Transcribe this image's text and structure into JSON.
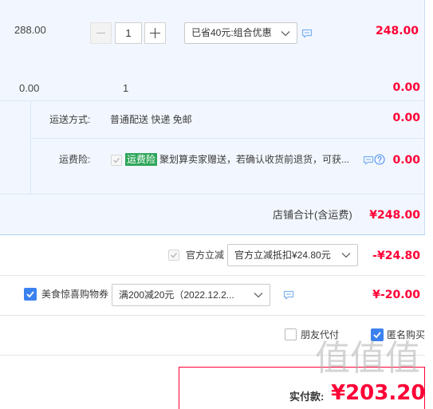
{
  "colors": {
    "price_red": "#ff0036",
    "section_bg": "#f2f7ff",
    "checkbox_blue": "#3b82f0",
    "tag_green": "#2ea65a",
    "icon_blue": "#7fb2ee"
  },
  "icons": {
    "minus": "minus-icon",
    "plus": "plus-icon",
    "dropdown": "chevron-down-icon",
    "chat": "chat-bubble-icon",
    "help": "question-circle-icon",
    "check": "checkmark-icon"
  },
  "order_item": {
    "unit_price": "288.00",
    "quantity": "1",
    "promo_select": "已省40元:组合优惠",
    "subtotal": "248.00"
  },
  "gift_item": {
    "unit_price": "0.00",
    "quantity": "1",
    "subtotal": "0.00"
  },
  "shipping": {
    "label": "运送方式:",
    "method": "普通配送 快递 免邮",
    "fee": "0.00"
  },
  "insurance": {
    "label": "运费险:",
    "checked": true,
    "tag": "运费险",
    "description": "聚划算卖家赠送，若确认收货前退货，可获...",
    "fee": "0.00"
  },
  "shop_total": {
    "label": "店铺合计(含运费)",
    "amount": "¥248.00"
  },
  "official_discount": {
    "checked": true,
    "label": "官方立减",
    "select": "官方立减抵扣¥24.80元",
    "amount": "-¥24.80"
  },
  "coupon": {
    "checked": true,
    "label": "美食惊喜购物券",
    "select": "满200减20元（2022.12.2...",
    "amount": "¥-20.00"
  },
  "options": {
    "friend_pay": {
      "label": "朋友代付",
      "checked": false
    },
    "anonymous": {
      "label": "匿名购买",
      "checked": true
    }
  },
  "payment": {
    "label": "实付款:",
    "amount": "¥203.20"
  },
  "watermark": "值值值"
}
